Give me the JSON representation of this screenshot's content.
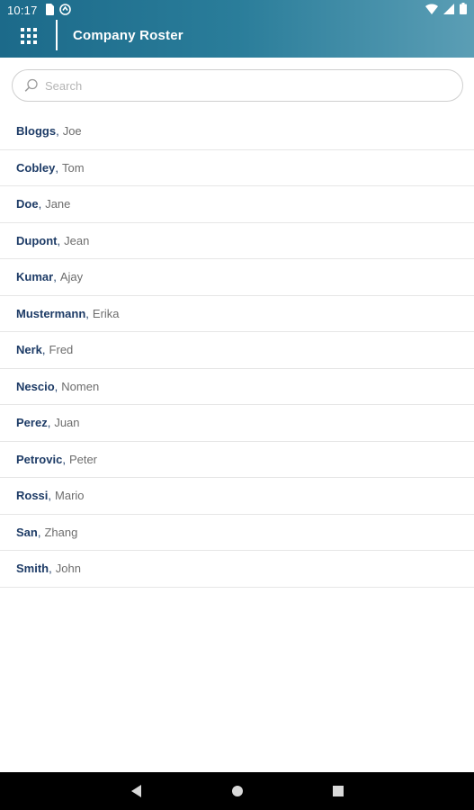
{
  "status_bar": {
    "time": "10:17"
  },
  "toolbar": {
    "title": "Company Roster",
    "apps_icon": "grid-icon"
  },
  "search": {
    "placeholder": "Search",
    "value": ""
  },
  "roster": [
    {
      "last": "Bloggs",
      "first": "Joe"
    },
    {
      "last": "Cobley",
      "first": "Tom"
    },
    {
      "last": "Doe",
      "first": "Jane"
    },
    {
      "last": "Dupont",
      "first": "Jean"
    },
    {
      "last": "Kumar",
      "first": "Ajay"
    },
    {
      "last": "Mustermann",
      "first": "Erika"
    },
    {
      "last": "Nerk",
      "first": "Fred"
    },
    {
      "last": "Nescio",
      "first": "Nomen"
    },
    {
      "last": "Perez",
      "first": "Juan"
    },
    {
      "last": "Petrovic",
      "first": "Peter"
    },
    {
      "last": "Rossi",
      "first": "Mario"
    },
    {
      "last": "San",
      "first": "Zhang"
    },
    {
      "last": "Smith",
      "first": "John"
    }
  ],
  "colors": {
    "header_start": "#1c6a8a",
    "header_end": "#5b9eb5",
    "last_name": "#1d3b66",
    "first_name": "#6d6d6d"
  }
}
